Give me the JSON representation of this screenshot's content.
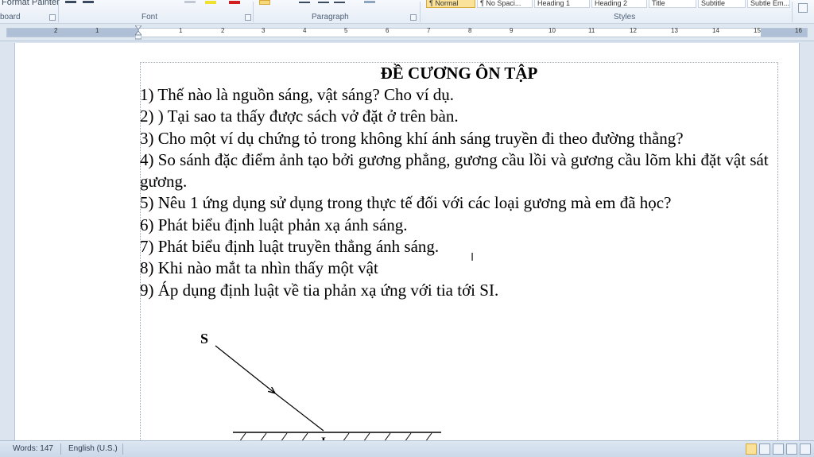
{
  "ribbon": {
    "format_painter_label": "Format Painter",
    "clipboard_label": "board",
    "font_group_label": "Font",
    "paragraph_group_label": "Paragraph",
    "styles_group_label": "Styles",
    "style_items": [
      "¶ Normal",
      "¶ No Spaci...",
      "Heading 1",
      "Heading 2",
      "Title",
      "Subtitle",
      "Subtle Em..."
    ]
  },
  "ruler": {
    "numbers": [
      "2",
      "1",
      "1",
      "1",
      "2",
      "3",
      "4",
      "5",
      "6",
      "7",
      "8",
      "9",
      "10",
      "11",
      "12",
      "13",
      "14",
      "15",
      "16"
    ]
  },
  "document": {
    "title": "ĐỀ CƯƠNG ÔN TẬP",
    "lines": [
      "1) Thế nào là nguồn sáng, vật sáng? Cho ví dụ.",
      "2) ) Tại sao ta thấy được sách vở đặt  ở trên bàn.",
      "3) Cho một ví dụ chứng tỏ trong không khí ánh sáng truyền đi theo đường thẳng?",
      "4) So sánh đặc điểm ảnh tạo bởi gương phẳng, gương cầu lồi và gương cầu lõm khi đặt vật sát gương.",
      "5) Nêu 1 ứng dụng sử dụng trong thực tế đối với các loại gương mà em đã học?",
      "6) Phát biểu định luật phản xạ ánh sáng.",
      "7) Phát biểu định luật truyền thẳng ánh sáng.",
      "8) Khi nào mắt ta nhìn thấy một vật",
      "9) Áp dụng định luật về tia phản xạ ứng với tia tới SI."
    ],
    "figure": {
      "label_s": "S",
      "label_i": "I"
    }
  },
  "statusbar": {
    "words": "Words: 147",
    "language": "English (U.S.)"
  },
  "colors": {
    "ribbon_bg": "#e6edf6",
    "statusbar_bg": "#cbd8e8",
    "page_bg": "#ffffff"
  }
}
